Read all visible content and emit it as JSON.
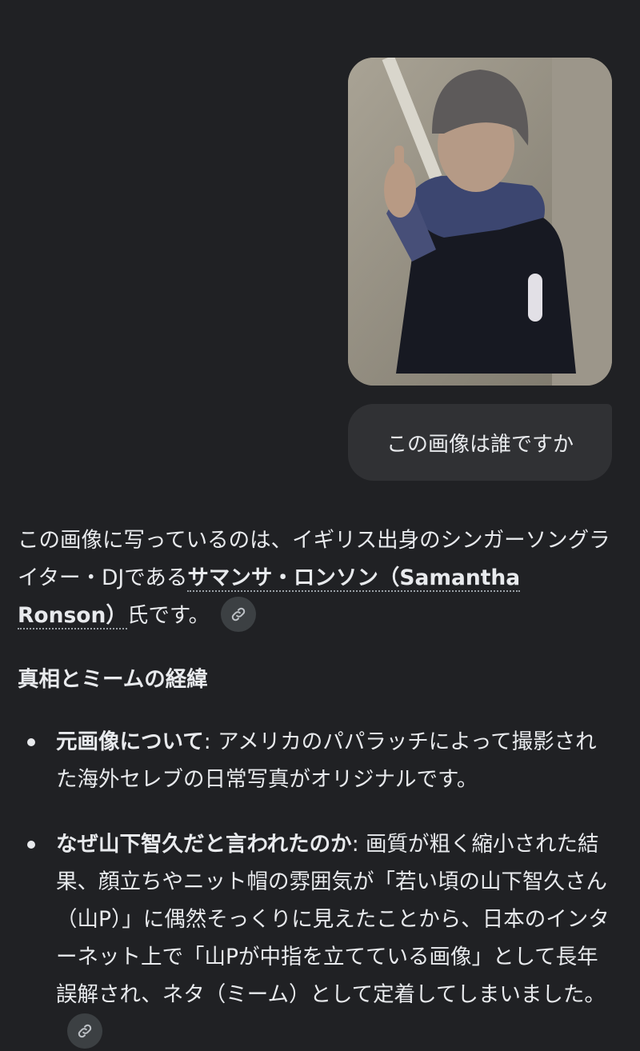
{
  "user_message": {
    "text": "この画像は誰ですか"
  },
  "response": {
    "intro_before": "この画像に写っているのは、イギリス出身のシンガーソングライター・DJである",
    "entity_name": "サマンサ・ロンソン（Samantha Ronson）",
    "intro_after": "氏です。",
    "section_title": "真相とミームの経緯",
    "bullets": [
      {
        "title": "元画像について",
        "text": ": アメリカのパパラッチによって撮影された海外セレブの日常写真がオリジナルです。"
      },
      {
        "title": "なぜ山下智久だと言われたのか",
        "text": ": 画質が粗く縮小された結果、顔立ちやニット帽の雰囲気が「若い頃の山下智久さん（山P）」に偶然そっくりに見えたことから、日本のインターネット上で「山Pが中指を立てている画像」として長年誤解され、ネタ（ミーム）として定着してしまいました。"
      }
    ]
  },
  "icons": {
    "source_link": "link-icon"
  },
  "colors": {
    "background": "#202124",
    "bubble": "#303134",
    "text": "#e8eaed",
    "chip": "#3c4043"
  }
}
